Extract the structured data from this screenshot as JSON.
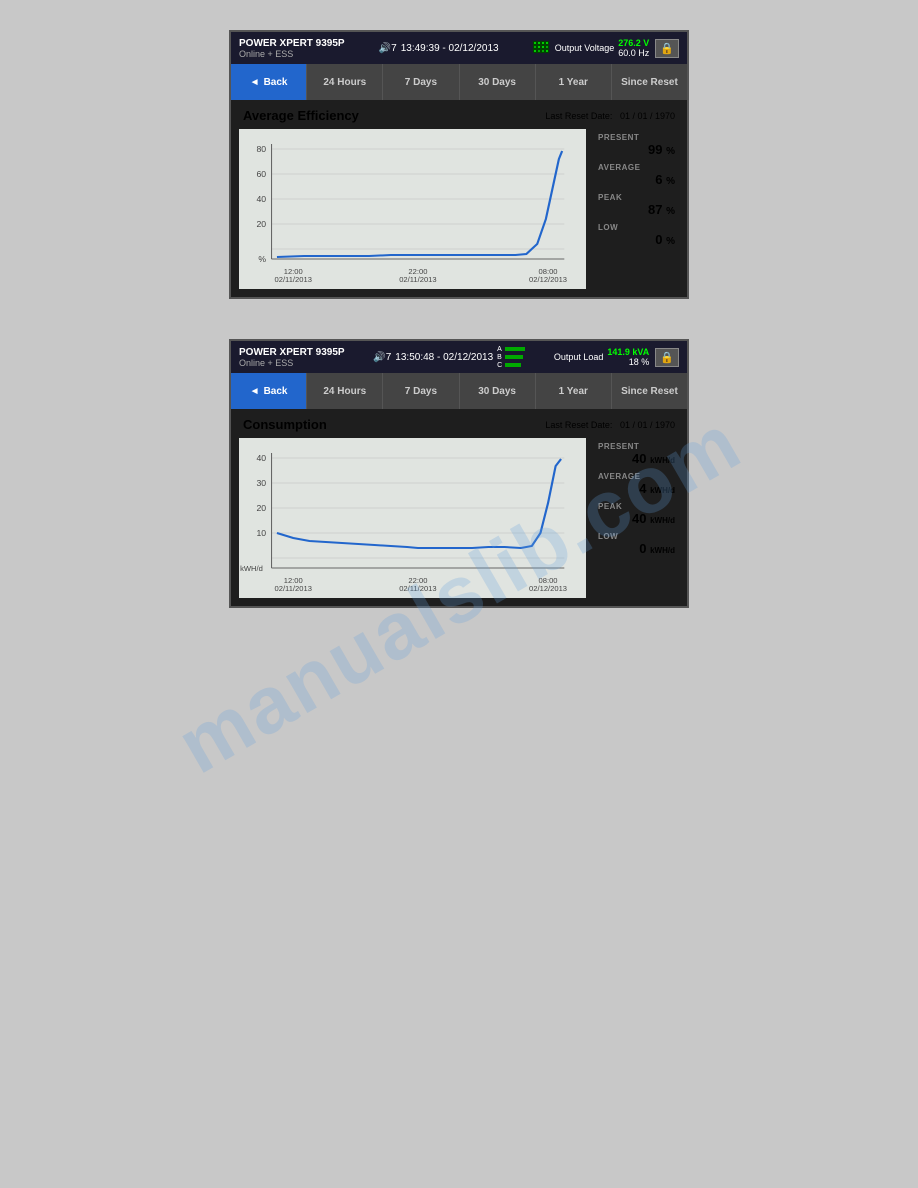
{
  "panel1": {
    "header": {
      "title": "POWER XPERT 9395P",
      "subtitle": "Online + ESS",
      "datetime": "13:49:39 - 02/12/2013",
      "icon": "🔊7",
      "output_label": "Output Voltage",
      "output_value": "276.2 V",
      "hz": "60.0 Hz",
      "lock": "🔒"
    },
    "tabs": [
      {
        "label": "◄ Back",
        "key": "back",
        "active": true
      },
      {
        "label": "24 Hours",
        "key": "24h",
        "active": false
      },
      {
        "label": "7 Days",
        "key": "7d",
        "active": false
      },
      {
        "label": "30 Days",
        "key": "30d",
        "active": false
      },
      {
        "label": "1 Year",
        "key": "1y",
        "active": false
      },
      {
        "label": "Since Reset",
        "key": "since",
        "active": false
      }
    ],
    "content": {
      "title": "Average Efficiency",
      "reset_date_label": "Last Reset Date:",
      "reset_date": "01 / 01 / 1970",
      "x_labels": [
        "12:00\n02/11/2013",
        "22:00\n02/11/2013",
        "08:00\n02/12/2013"
      ],
      "y_labels": [
        "80",
        "60",
        "40",
        "20",
        "%"
      ],
      "stats": {
        "present_label": "PRESENT",
        "present_value": "99",
        "present_unit": "%",
        "average_label": "AVERAGE",
        "average_value": "6",
        "average_unit": "%",
        "peak_label": "PEAK",
        "peak_value": "87",
        "peak_unit": "%",
        "low_label": "LOW",
        "low_value": "0",
        "low_unit": "%"
      }
    }
  },
  "panel2": {
    "header": {
      "title": "POWER XPERT 9395P",
      "subtitle": "Online + ESS",
      "datetime": "13:50:48 - 02/12/2013",
      "icon": "🔊7",
      "output_label": "Output Load",
      "output_value": "141.9 kVA",
      "pct": "18 %",
      "lock": "🔒"
    },
    "tabs": [
      {
        "label": "◄ Back",
        "key": "back",
        "active": true
      },
      {
        "label": "24 Hours",
        "key": "24h",
        "active": false
      },
      {
        "label": "7 Days",
        "key": "7d",
        "active": false
      },
      {
        "label": "30 Days",
        "key": "30d",
        "active": false
      },
      {
        "label": "1 Year",
        "key": "1y",
        "active": false
      },
      {
        "label": "Since Reset",
        "key": "since",
        "active": false
      }
    ],
    "content": {
      "title": "Consumption",
      "reset_date_label": "Last Reset Date:",
      "reset_date": "01 / 01 / 1970",
      "x_labels": [
        "12:00\n02/11/2013",
        "22:00\n02/11/2013",
        "08:00\n02/12/2013"
      ],
      "y_labels": [
        "40",
        "30",
        "20",
        "10",
        "kWH/d"
      ],
      "stats": {
        "present_label": "PRESENT",
        "present_value": "40",
        "present_unit": "kWH/d",
        "average_label": "AVERAGE",
        "average_value": "4",
        "average_unit": "kWH/d",
        "peak_label": "PEAK",
        "peak_value": "40",
        "peak_unit": "kWH/d",
        "low_label": "LOW",
        "low_value": "0",
        "low_unit": "kWH/d"
      }
    }
  },
  "watermark": "manualslib.com"
}
